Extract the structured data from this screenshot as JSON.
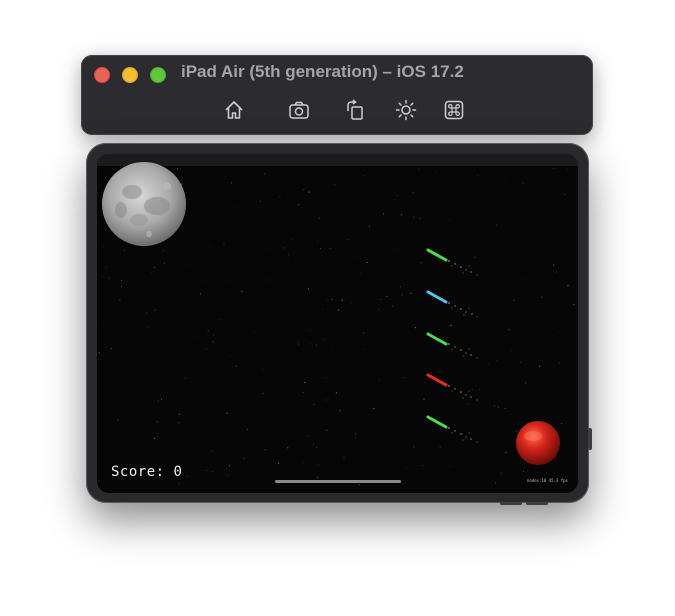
{
  "window": {
    "title": "iPad Air (5th generation) – iOS 17.2",
    "toolbar": [
      {
        "icon": "home-icon"
      },
      {
        "icon": "screenshot-icon"
      },
      {
        "icon": "rotate-icon"
      },
      {
        "icon": "appearance-icon"
      },
      {
        "icon": "command-icon"
      }
    ],
    "colors": {
      "close": "#ec5f57",
      "minimize": "#f3bd2f",
      "maximize": "#5fc73b",
      "title_bar": "#2c2b30"
    }
  },
  "game": {
    "score_text": "Score: 0",
    "debug_text": "nodes:18  45.3 fps",
    "lasers": [
      {
        "color": "#4be04b"
      },
      {
        "color": "#4fc7f0"
      },
      {
        "color": "#4be04b"
      },
      {
        "color": "#ee2a22"
      },
      {
        "color": "#4be04b"
      }
    ],
    "background": "#060606"
  }
}
